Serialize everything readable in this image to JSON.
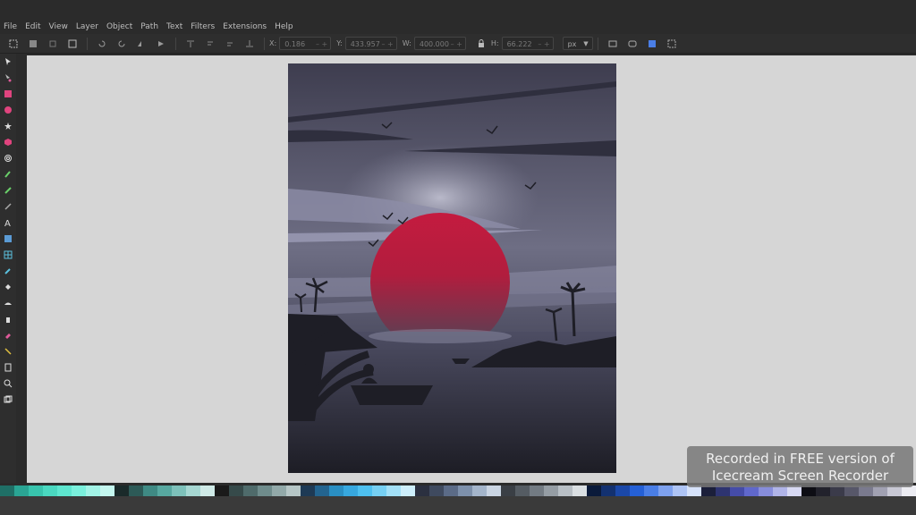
{
  "menu": [
    "File",
    "Edit",
    "View",
    "Layer",
    "Object",
    "Path",
    "Text",
    "Filters",
    "Extensions",
    "Help"
  ],
  "toolbar": {
    "x_label": "X:",
    "x_value": "0.186",
    "y_label": "Y:",
    "y_value": "433.957",
    "w_label": "W:",
    "w_value": "400.000",
    "h_label": "H:",
    "h_value": "66.222",
    "unit": "px"
  },
  "toolbox_icons": [
    "select-icon",
    "node-edit-icon",
    "rectangle-icon",
    "circle-icon",
    "star-icon",
    "3d-box-icon",
    "spiral-icon",
    "pen-icon",
    "pencil-icon",
    "calligraphy-icon",
    "text-icon",
    "gradient-icon",
    "mesh-icon",
    "dropper-icon",
    "paint-bucket-icon",
    "tweak-icon",
    "spray-icon",
    "eraser-icon",
    "connector-icon",
    "pages-icon",
    "zoom-icon",
    "measure-icon"
  ],
  "palette_colors": [
    "#1f6f66",
    "#2aa594",
    "#38c4ad",
    "#4ad8c0",
    "#5ee6cf",
    "#7af0dc",
    "#a2f3e6",
    "#c4f7ef",
    "#1a2a2a",
    "#2d5a57",
    "#3f8a84",
    "#57a8a0",
    "#7dc1ba",
    "#a6d7d2",
    "#cfeae7",
    "#1a1a1a",
    "#364a4a",
    "#4f6b6b",
    "#6f8c8c",
    "#92a9a9",
    "#b6c6c6",
    "#1e3a55",
    "#23648f",
    "#2a8fc3",
    "#37a8df",
    "#4ec0ef",
    "#76d0f3",
    "#a3e0f7",
    "#cdeefb",
    "#2b3040",
    "#3f4a5f",
    "#5b6b87",
    "#7d90ab",
    "#a4b5cb",
    "#caD5e3",
    "#3a3f45",
    "#555c63",
    "#737b83",
    "#959da4",
    "#b8bfc5",
    "#dadfe2",
    "#0a1a3a",
    "#133170",
    "#1b48a8",
    "#2560d6",
    "#4a7ee6",
    "#7ea1ee",
    "#aec4f5",
    "#d6e2fa",
    "#1b1f3a",
    "#2e3470",
    "#454ca8",
    "#6068cc",
    "#878ddb",
    "#b0b4e8",
    "#d7d9f3",
    "#0d0d14",
    "#22222c",
    "#3b3b4a",
    "#575769",
    "#7a7a8e",
    "#a1a1b2",
    "#c8c8d4",
    "#ececf2"
  ],
  "watermark": {
    "line1": "Recorded in FREE version of",
    "line2": "Icecream Screen Recorder"
  }
}
